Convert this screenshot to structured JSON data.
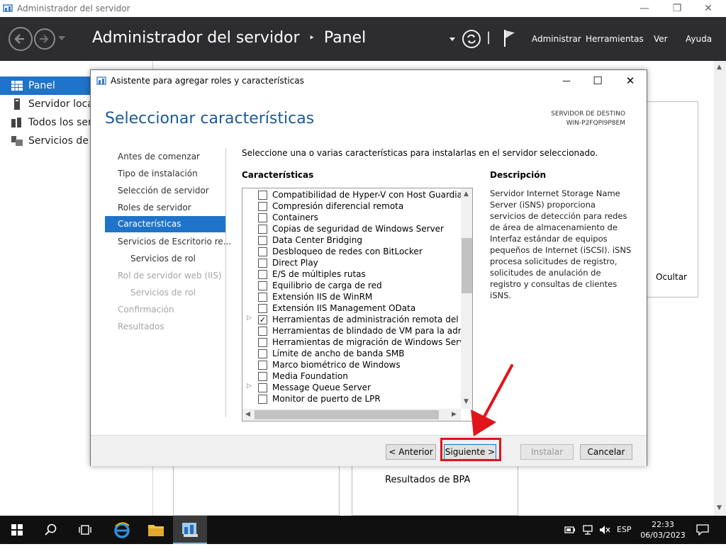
{
  "outer_window": {
    "title": "Administrador del servidor",
    "minimize_glyph": "—",
    "restore_glyph": "❐",
    "close_glyph": "✕"
  },
  "header": {
    "breadcrumb_app": "Administrador del servidor",
    "breadcrumb_sep": "‣",
    "breadcrumb_page": "Panel",
    "menu_manage": "Administrar",
    "menu_tools": "Herramientas",
    "menu_view": "Ver",
    "menu_help": "Ayuda",
    "separator": "|"
  },
  "left_nav": {
    "items": [
      {
        "label": "Panel"
      },
      {
        "label": "Servidor local"
      },
      {
        "label": "Todos los serv"
      },
      {
        "label": "Servicios de ar"
      }
    ]
  },
  "background": {
    "hide_label": "Ocultar",
    "bpa_label": "Resultados de BPA"
  },
  "wizard": {
    "title": "Asistente para agregar roles y características",
    "heading": "Seleccionar características",
    "dest_server_label": "SERVIDOR DE DESTINO",
    "dest_server_name": "WIN-P2FQPI9P8EM",
    "steps": [
      {
        "label": "Antes de comenzar"
      },
      {
        "label": "Tipo de instalación"
      },
      {
        "label": "Selección de servidor"
      },
      {
        "label": "Roles de servidor"
      },
      {
        "label": "Características"
      },
      {
        "label": "Servicios de Escritorio re..."
      },
      {
        "label": "Servicios de rol"
      },
      {
        "label": "Rol de servidor web (IIS)"
      },
      {
        "label": "Servicios de rol"
      },
      {
        "label": "Confirmación"
      },
      {
        "label": "Resultados"
      }
    ],
    "instructions": "Seleccione una o varias características para instalarlas en el servidor seleccionado.",
    "features_header": "Características",
    "description_header": "Descripción",
    "description_text": "Servidor Internet Storage Name Server (iSNS) proporciona servicios de detección para redes de área de almacenamiento de Interfaz estándar de equipos pequeños de Internet (iSCSI). iSNS procesa solicitudes de registro, solicitudes de anulación de registro y consultas de clientes iSNS.",
    "features": [
      {
        "label": "Compatibilidad de Hyper-V con Host Guardian",
        "check": ""
      },
      {
        "label": "Compresión diferencial remota",
        "check": ""
      },
      {
        "label": "Containers",
        "check": ""
      },
      {
        "label": "Copias de seguridad de Windows Server",
        "check": ""
      },
      {
        "label": "Data Center Bridging",
        "check": ""
      },
      {
        "label": "Desbloqueo de redes con BitLocker",
        "check": ""
      },
      {
        "label": "Direct Play",
        "check": ""
      },
      {
        "label": "E/S de múltiples rutas",
        "check": ""
      },
      {
        "label": "Equilibrio de carga de red",
        "check": ""
      },
      {
        "label": "Extensión IIS de WinRM",
        "check": ""
      },
      {
        "label": "Extensión IIS Management OData",
        "check": ""
      },
      {
        "label": "Herramientas de administración remota del servid",
        "check": "✓",
        "expandable": true
      },
      {
        "label": "Herramientas de blindado de VM para la administ",
        "check": ""
      },
      {
        "label": "Herramientas de migración de Windows Server",
        "check": ""
      },
      {
        "label": "Límite de ancho de banda SMB",
        "check": ""
      },
      {
        "label": "Marco biométrico de Windows",
        "check": ""
      },
      {
        "label": "Media Foundation",
        "check": ""
      },
      {
        "label": "Message Queue Server",
        "check": "",
        "expandable": true
      },
      {
        "label": "Monitor de puerto de LPR",
        "check": ""
      }
    ],
    "expander_glyph": "▷",
    "buttons": {
      "previous": "< Anterior",
      "next": "Siguiente >",
      "install": "Instalar",
      "cancel": "Cancelar"
    },
    "window_controls": {
      "minimize": "—",
      "maximize": "☐",
      "close": "✕"
    }
  },
  "taskbar": {
    "language": "ESP",
    "time": "22:33",
    "date": "06/03/2023"
  },
  "colors": {
    "accent": "#1f73c8",
    "header_bg": "#2d2d30",
    "heading_blue": "#1a5a96",
    "annotation_red": "#e0141a"
  }
}
